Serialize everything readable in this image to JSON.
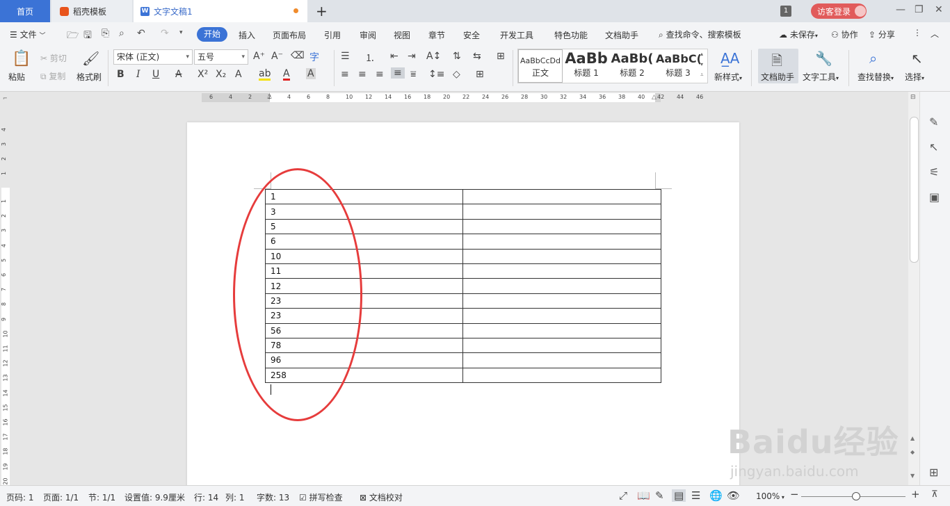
{
  "tabs": {
    "home": "首页",
    "daoke": "稻壳模板",
    "document": "文字文稿1",
    "window_count": "1",
    "login": "访客登录"
  },
  "menu": {
    "file": "文件",
    "items": [
      "开始",
      "插入",
      "页面布局",
      "引用",
      "审阅",
      "视图",
      "章节",
      "安全",
      "开发工具",
      "特色功能",
      "文档助手"
    ],
    "search": "查找命令、搜索模板",
    "unsaved": "未保存",
    "collab": "协作",
    "share": "分享"
  },
  "ribbon": {
    "paste": "粘贴",
    "cut": "剪切",
    "copy": "复制",
    "format_painter": "格式刷",
    "font_name": "宋体 (正文)",
    "font_size": "五号",
    "styles": [
      {
        "sample": "AaBbCcDd",
        "name": "正文"
      },
      {
        "sample": "AaBb",
        "name": "标题 1"
      },
      {
        "sample": "AaBb(",
        "name": "标题 2"
      },
      {
        "sample": "AaBbC(",
        "name": "标题 3"
      }
    ],
    "new_style": "新样式",
    "doc_assistant": "文档助手",
    "text_tools": "文字工具",
    "find_replace": "查找替换",
    "select": "选择"
  },
  "ruler": {
    "h_numbers": [
      "6",
      "4",
      "2",
      "2",
      "4",
      "6",
      "8",
      "10",
      "12",
      "14",
      "16",
      "18",
      "20",
      "22",
      "24",
      "26",
      "28",
      "30",
      "32",
      "34",
      "36",
      "38",
      "40",
      "42",
      "44",
      "46"
    ],
    "v_numbers": [
      "4",
      "3",
      "2",
      "1",
      "1",
      "2",
      "3",
      "4",
      "5",
      "6",
      "7",
      "8",
      "9",
      "10",
      "11",
      "12",
      "13",
      "14",
      "15",
      "16",
      "17",
      "18",
      "19",
      "20"
    ]
  },
  "table": {
    "rows": [
      [
        "1",
        ""
      ],
      [
        "3",
        ""
      ],
      [
        "5",
        ""
      ],
      [
        "6",
        ""
      ],
      [
        "10",
        ""
      ],
      [
        "11",
        ""
      ],
      [
        "12",
        ""
      ],
      [
        "23",
        ""
      ],
      [
        "23",
        ""
      ],
      [
        "56",
        ""
      ],
      [
        "78",
        ""
      ],
      [
        "96",
        ""
      ],
      [
        "258",
        ""
      ]
    ]
  },
  "status": {
    "page_num": "页码: 1",
    "pages": "页面: 1/1",
    "section": "节: 1/1",
    "setting": "设置值: 9.9厘米",
    "row": "行: 14",
    "col": "列: 1",
    "word_count": "字数: 13",
    "spell_check": "拼写检查",
    "doc_proof": "文档校对",
    "zoom": "100%"
  },
  "watermark": {
    "main": "Baidu经验",
    "sub": "jingyan.baidu.com"
  },
  "colors": {
    "accent": "#3b73d6",
    "annotation": "#e63c3c",
    "login": "#e15b5b"
  }
}
